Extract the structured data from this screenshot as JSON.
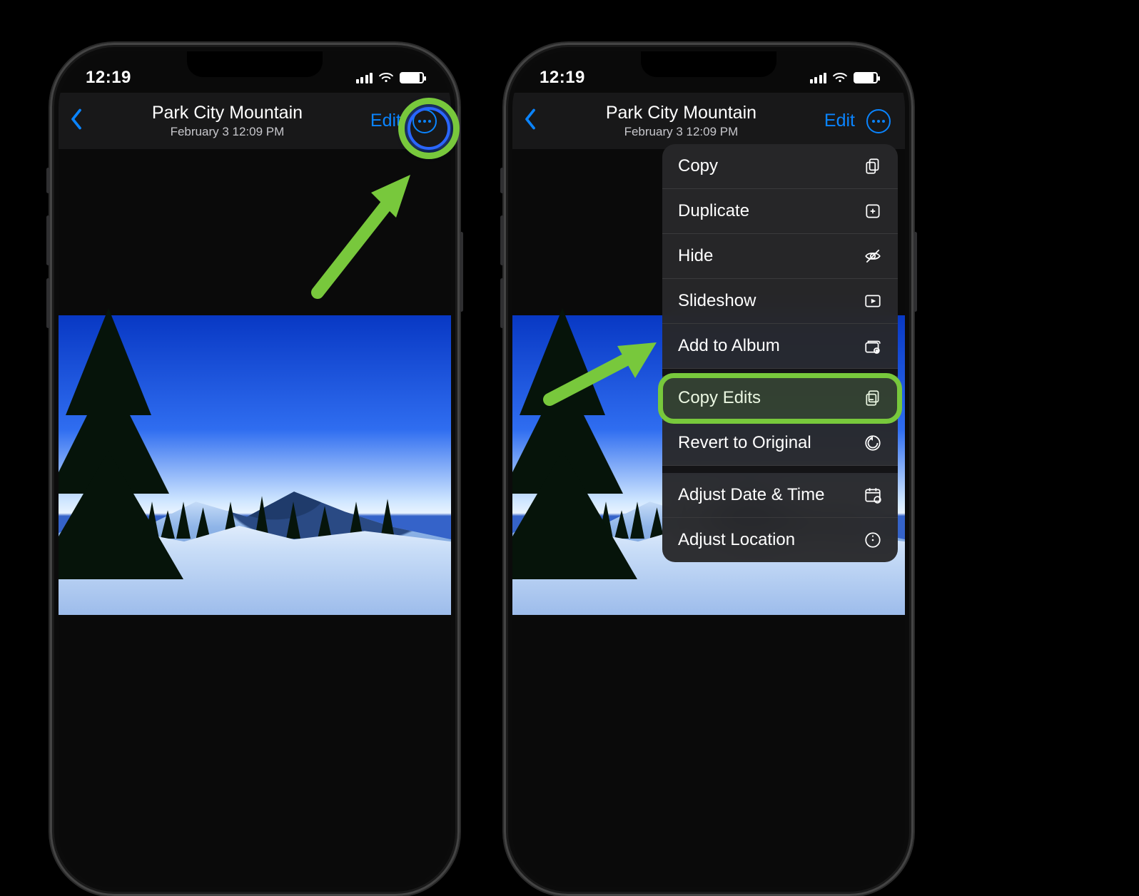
{
  "status": {
    "time": "12:19"
  },
  "nav": {
    "title": "Park City Mountain",
    "subtitle": "February 3  12:09 PM",
    "edit_label": "Edit"
  },
  "menu": {
    "items": [
      {
        "label": "Copy",
        "icon": "copy"
      },
      {
        "label": "Duplicate",
        "icon": "duplicate"
      },
      {
        "label": "Hide",
        "icon": "hide"
      },
      {
        "label": "Slideshow",
        "icon": "slideshow"
      },
      {
        "label": "Add to Album",
        "icon": "album",
        "gap_after": true
      },
      {
        "label": "Copy Edits",
        "icon": "copyedits",
        "highlight": true
      },
      {
        "label": "Revert to Original",
        "icon": "revert",
        "gap_after": true
      },
      {
        "label": "Adjust Date & Time",
        "icon": "datetime"
      },
      {
        "label": "Adjust Location",
        "icon": "location"
      }
    ]
  }
}
